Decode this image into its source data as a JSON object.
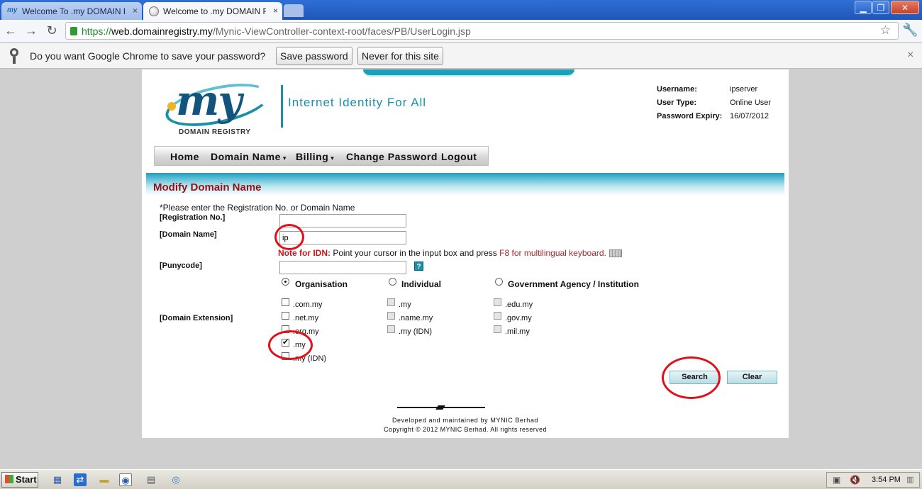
{
  "browser": {
    "tabs": [
      {
        "favicon": "my",
        "title": "Welcome To .my DOMAIN REG",
        "close": "×"
      },
      {
        "title": "Welcome to .my DOMAIN REG",
        "close": "×"
      }
    ],
    "window_controls": {
      "minimize": "▁",
      "maximize": "❐",
      "close": "✕"
    },
    "nav": {
      "back": "←",
      "forward": "→",
      "reload": "↻"
    },
    "url": {
      "scheme": "https://",
      "host": "web.domainregistry.my",
      "path": "/Mynic-ViewController-context-root/faces/PB/UserLogin.jsp"
    },
    "star_icon": "☆",
    "wrench_icon": "🔧",
    "infobar": {
      "text": "Do you want Google Chrome to save your password?",
      "save_label": "Save password",
      "never_label": "Never for this site",
      "close": "×"
    }
  },
  "header": {
    "logo_mark": "my",
    "logo_text": "DOMAIN REGISTRY",
    "tagline": "Internet Identity For All",
    "user": {
      "username_label": "Username:",
      "username_value": "ipserver",
      "usertype_label": "User Type:",
      "usertype_value": "Online User",
      "expiry_label": "Password Expiry:",
      "expiry_value": "16/07/2012"
    }
  },
  "menu": {
    "home": "Home",
    "domain_name": "Domain Name",
    "billing": "Billing",
    "change_password": "Change Password",
    "logout": "Logout",
    "caret": "▾"
  },
  "form": {
    "section_title": "Modify Domain Name",
    "instruction": "*Please enter the Registration No. or Domain Name",
    "registration_label": "[Registration No.]",
    "registration_value": "",
    "domain_label": "[Domain Name]",
    "domain_value": "ip",
    "idn_note_label": "Note for IDN:",
    "idn_note_text": " Point your cursor in the input box and press ",
    "idn_note_hint": "F8 for multilingual keyboard.",
    "punycode_label": "[Punycode]",
    "punycode_value": "",
    "help_icon": "?",
    "radio_organisation": "Organisation",
    "radio_individual": "Individual",
    "radio_government": "Government Agency / Institution",
    "extension_label": "[Domain Extension]",
    "ext_col1": [
      ".com.my",
      ".net.my",
      ".org.my",
      ".my",
      ".my (IDN)"
    ],
    "ext_col2": [
      ".my",
      ".name.my",
      ".my (IDN)"
    ],
    "ext_col3": [
      ".edu.my",
      ".gov.my",
      ".mil.my"
    ],
    "search_label": "Search",
    "clear_label": "Clear"
  },
  "footer": {
    "developed": "Developed and maintained by MYNIC Berhad",
    "copyright": "Copyright © 2012 MYNIC Berhad. All rights reserved"
  },
  "taskbar": {
    "start_label": "Start",
    "clock": "3:54 PM"
  },
  "colors": {
    "brand_teal": "#1a8fa8",
    "title_red": "#9a0f16",
    "annotation_red": "#e0111a"
  }
}
